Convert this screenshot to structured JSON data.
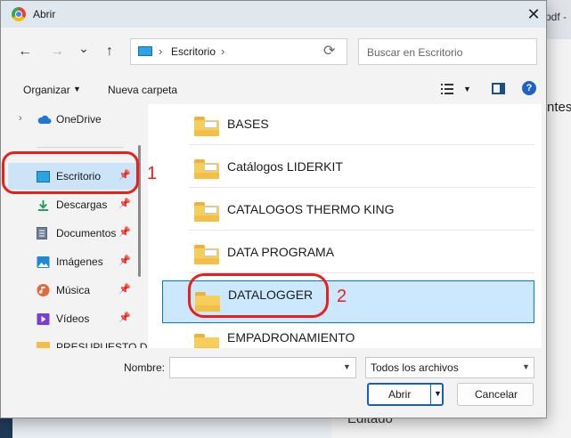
{
  "background": {
    "pdf_fragment": "pdf -",
    "text_fragment": "ntes",
    "bottom_text": "Editado"
  },
  "window": {
    "title": "Abrir",
    "close": "✕"
  },
  "nav_buttons": {
    "back": "←",
    "forward": "→",
    "recent": "⌄",
    "up": "↑"
  },
  "address": {
    "path": "Escritorio",
    "sep": "›",
    "refresh": "⟳"
  },
  "search": {
    "placeholder": "Buscar en Escritorio"
  },
  "toolbar": {
    "organize": "Organizar",
    "new_folder": "Nueva carpeta",
    "help": "?"
  },
  "sidebar": {
    "items": [
      {
        "label": "OneDrive",
        "icon": "cloud-icon",
        "pinned": false
      },
      {
        "label": "Escritorio",
        "icon": "desktop-icon",
        "pinned": true,
        "selected": true
      },
      {
        "label": "Descargas",
        "icon": "download-icon",
        "pinned": true
      },
      {
        "label": "Documentos",
        "icon": "document-icon",
        "pinned": true
      },
      {
        "label": "Imágenes",
        "icon": "image-icon",
        "pinned": true
      },
      {
        "label": "Música",
        "icon": "music-icon",
        "pinned": true
      },
      {
        "label": "Vídeos",
        "icon": "video-icon",
        "pinned": true
      },
      {
        "label": "PRESUPUESTO D",
        "icon": "folder-icon",
        "pinned": false
      }
    ]
  },
  "files": [
    {
      "name": "BASES",
      "selected": false
    },
    {
      "name": "Catálogos LIDERKIT",
      "selected": false
    },
    {
      "name": "CATALOGOS THERMO KING",
      "selected": false
    },
    {
      "name": "DATA PROGRAMA",
      "selected": false
    },
    {
      "name": "DATALOGGER",
      "selected": true
    },
    {
      "name": "EMPADRONAMIENTO",
      "selected": false
    }
  ],
  "footer": {
    "filename_label": "Nombre:",
    "filename_value": "",
    "filter": "Todos los archivos",
    "open": "Abrir",
    "cancel": "Cancelar"
  },
  "annotations": {
    "mark1": "1",
    "mark2": "2"
  },
  "colors": {
    "selection": "#cce8ff",
    "accent": "#0078d7",
    "annotation": "#e8201a"
  }
}
